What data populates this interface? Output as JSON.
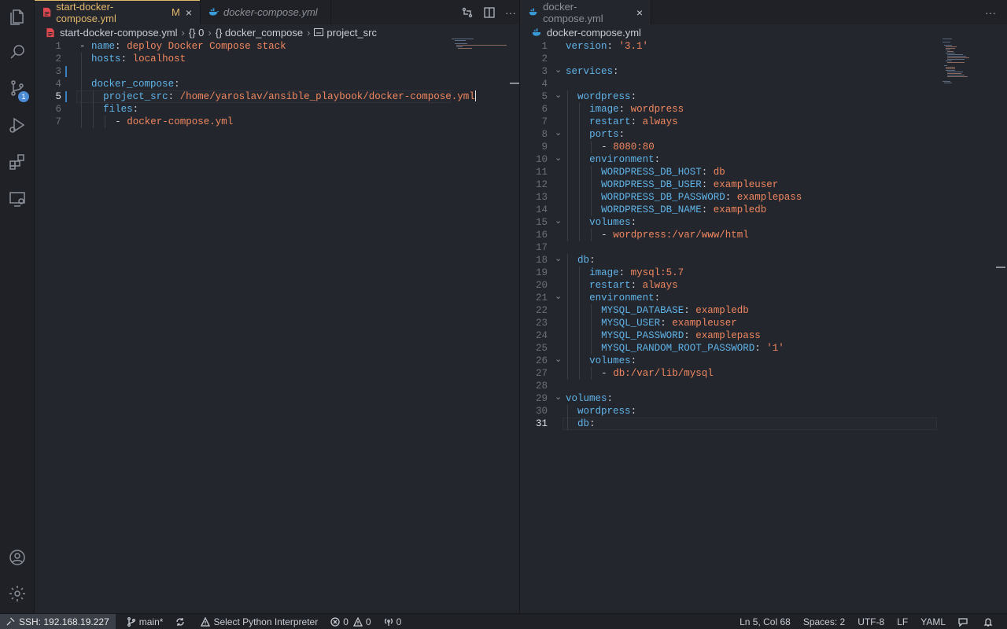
{
  "left_group": {
    "tabs": [
      {
        "label": "start-docker-compose.yml",
        "modified": "M",
        "close": "×",
        "active": true
      },
      {
        "label": "docker-compose.yml",
        "italic": true
      }
    ],
    "breadcrumb": [
      "start-docker-compose.yml",
      "{} 0",
      "{} docker_compose",
      "project_src"
    ],
    "lines": [
      {
        "n": "1",
        "indent": 0,
        "dash": "- ",
        "key": "name",
        "value": "deploy Docker Compose stack"
      },
      {
        "n": "2",
        "indent": 1,
        "key": "hosts",
        "value": "localhost"
      },
      {
        "n": "3",
        "indent": 1,
        "key": "",
        "value": ""
      },
      {
        "n": "4",
        "indent": 1,
        "key": "docker_compose",
        "value": ""
      },
      {
        "n": "5",
        "indent": 2,
        "key": "project_src",
        "value": "/home/yaroslav/ansible_playbook/docker-compose.yml"
      },
      {
        "n": "6",
        "indent": 2,
        "key": "files",
        "value": ""
      },
      {
        "n": "7",
        "indent": 3,
        "dash": "- ",
        "key": "",
        "value": "docker-compose.yml"
      }
    ],
    "current_line": "5"
  },
  "right_group": {
    "tabs": [
      {
        "label": "docker-compose.yml",
        "close": "×",
        "active": true
      }
    ],
    "more": "···",
    "breadcrumb": [
      "docker-compose.yml"
    ],
    "lines": [
      {
        "n": "1",
        "indent": 0,
        "key": "version",
        "value": "'3.1'"
      },
      {
        "n": "2",
        "indent": 0,
        "key": "",
        "value": ""
      },
      {
        "n": "3",
        "indent": 0,
        "key": "services",
        "value": "",
        "fold": true
      },
      {
        "n": "4",
        "indent": 0,
        "key": "",
        "value": ""
      },
      {
        "n": "5",
        "indent": 1,
        "key": "wordpress",
        "value": "",
        "fold": true
      },
      {
        "n": "6",
        "indent": 2,
        "key": "image",
        "value": "wordpress"
      },
      {
        "n": "7",
        "indent": 2,
        "key": "restart",
        "value": "always"
      },
      {
        "n": "8",
        "indent": 2,
        "key": "ports",
        "value": "",
        "fold": true
      },
      {
        "n": "9",
        "indent": 3,
        "dash": "- ",
        "key": "",
        "value": "8080:80"
      },
      {
        "n": "10",
        "indent": 2,
        "key": "environment",
        "value": "",
        "fold": true
      },
      {
        "n": "11",
        "indent": 3,
        "key": "WORDPRESS_DB_HOST",
        "value": "db"
      },
      {
        "n": "12",
        "indent": 3,
        "key": "WORDPRESS_DB_USER",
        "value": "exampleuser"
      },
      {
        "n": "13",
        "indent": 3,
        "key": "WORDPRESS_DB_PASSWORD",
        "value": "examplepass"
      },
      {
        "n": "14",
        "indent": 3,
        "key": "WORDPRESS_DB_NAME",
        "value": "exampledb"
      },
      {
        "n": "15",
        "indent": 2,
        "key": "volumes",
        "value": "",
        "fold": true
      },
      {
        "n": "16",
        "indent": 3,
        "dash": "- ",
        "key": "",
        "value": "wordpress:/var/www/html"
      },
      {
        "n": "17",
        "indent": 0,
        "key": "",
        "value": ""
      },
      {
        "n": "18",
        "indent": 1,
        "key": "db",
        "value": "",
        "fold": true
      },
      {
        "n": "19",
        "indent": 2,
        "key": "image",
        "value": "mysql:5.7"
      },
      {
        "n": "20",
        "indent": 2,
        "key": "restart",
        "value": "always"
      },
      {
        "n": "21",
        "indent": 2,
        "key": "environment",
        "value": "",
        "fold": true
      },
      {
        "n": "22",
        "indent": 3,
        "key": "MYSQL_DATABASE",
        "value": "exampledb"
      },
      {
        "n": "23",
        "indent": 3,
        "key": "MYSQL_USER",
        "value": "exampleuser"
      },
      {
        "n": "24",
        "indent": 3,
        "key": "MYSQL_PASSWORD",
        "value": "examplepass"
      },
      {
        "n": "25",
        "indent": 3,
        "key": "MYSQL_RANDOM_ROOT_PASSWORD",
        "value": "'1'"
      },
      {
        "n": "26",
        "indent": 2,
        "key": "volumes",
        "value": "",
        "fold": true
      },
      {
        "n": "27",
        "indent": 3,
        "dash": "- ",
        "key": "",
        "value": "db:/var/lib/mysql"
      },
      {
        "n": "28",
        "indent": 0,
        "key": "",
        "value": ""
      },
      {
        "n": "29",
        "indent": 0,
        "key": "volumes",
        "value": "",
        "fold": true
      },
      {
        "n": "30",
        "indent": 1,
        "key": "wordpress",
        "value": ""
      },
      {
        "n": "31",
        "indent": 1,
        "key": "db",
        "value": ""
      }
    ],
    "current_line": "31"
  },
  "activity_bar": {
    "items": [
      "files-icon",
      "search-icon",
      "source-control-icon",
      "run-debug-icon",
      "extensions-icon",
      "remote-explorer-icon"
    ],
    "source_control_badge": "1",
    "bottom": [
      "account-icon",
      "settings-gear-icon"
    ]
  },
  "statusbar": {
    "remote": "SSH: 192.168.19.227",
    "branch": "main*",
    "python": "Select Python Interpreter",
    "errors": "0",
    "warnings": "0",
    "ports": "0",
    "position": "Ln 5, Col 68",
    "spaces": "Spaces: 2",
    "encoding": "UTF-8",
    "eol": "LF",
    "language": "YAML"
  },
  "colors": {
    "accent": "#4a8bd6",
    "key": "#5fb4e8",
    "string": "#f0875f",
    "modified": "#e2b86b"
  }
}
